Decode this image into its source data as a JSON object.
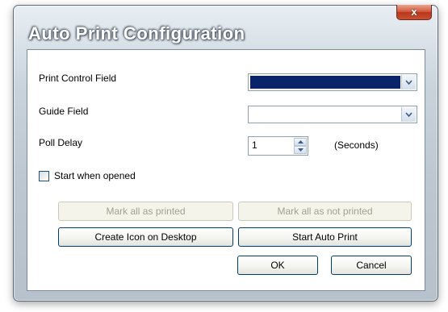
{
  "window": {
    "title": "Auto Print Configuration",
    "close_label": "x"
  },
  "fields": {
    "print_control_label": "Print Control Field",
    "print_control_value": "",
    "guide_label": "Guide Field",
    "guide_value": "",
    "poll_delay_label": "Poll Delay",
    "poll_delay_value": "1",
    "poll_delay_unit": "(Seconds)"
  },
  "options": {
    "start_when_opened_label": "Start when opened",
    "start_when_opened_checked": false
  },
  "buttons": {
    "mark_all_printed": "Mark all as printed",
    "mark_all_not_printed": "Mark all as not printed",
    "create_icon": "Create Icon on Desktop",
    "start_auto_print": "Start Auto Print",
    "ok": "OK",
    "cancel": "Cancel"
  },
  "colors": {
    "selection_fill": "#0a246a",
    "close_button": "#c8512f",
    "button_border": "#003c74"
  }
}
